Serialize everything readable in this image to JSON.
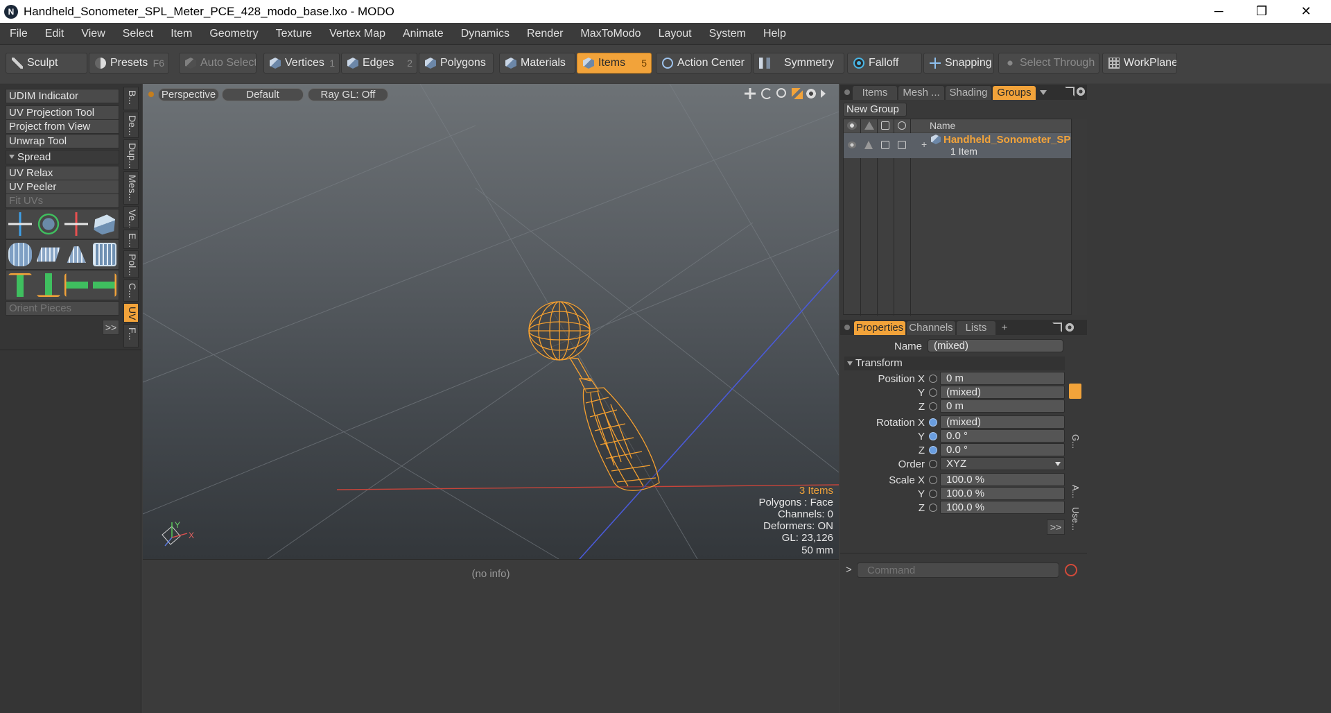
{
  "window": {
    "title": "Handheld_Sonometer_SPL_Meter_PCE_428_modo_base.lxo - MODO",
    "minimize": "─",
    "maximize": "❐",
    "close": "✕"
  },
  "menu": [
    "File",
    "Edit",
    "View",
    "Select",
    "Item",
    "Geometry",
    "Texture",
    "Vertex Map",
    "Animate",
    "Dynamics",
    "Render",
    "MaxToModo",
    "Layout",
    "System",
    "Help"
  ],
  "toolbar": {
    "sculpt": "Sculpt",
    "presets": "Presets",
    "presets_key": "F6",
    "auto_select": "Auto Select",
    "vertices": "Vertices",
    "vertices_key": "1",
    "edges": "Edges",
    "edges_key": "2",
    "polygons": "Polygons",
    "materials": "Materials",
    "items": "Items",
    "items_key": "5",
    "action_center": "Action Center",
    "symmetry": "Symmetry",
    "falloff": "Falloff",
    "snapping": "Snapping",
    "select_through": "Select Through",
    "workplane": "WorkPlane"
  },
  "left_tools": {
    "udim": "UDIM Indicator",
    "uv_projection": "UV Projection Tool",
    "project_from_view": "Project from View",
    "unwrap": "Unwrap Tool",
    "spread": "Spread",
    "uv_relax": "UV Relax",
    "uv_peeler": "UV Peeler",
    "fit_uvs": "Fit UVs",
    "orient_pieces": "Orient Pieces",
    "more": ">>"
  },
  "vertical_tabs": [
    "B...",
    "De...",
    "Dup...",
    "Mes...",
    "Ve...",
    "E...",
    "Pol...",
    "C...",
    "UV",
    "F..."
  ],
  "viewport": {
    "perspective": "Perspective",
    "default": "Default",
    "raygl": "Ray GL: Off",
    "info": {
      "items": "3 Items",
      "polygons": "Polygons : Face",
      "channels": "Channels: 0",
      "deformers": "Deformers: ON",
      "gl": "GL: 23,126",
      "scale": "50 mm"
    },
    "axis_x": "X",
    "axis_y": "Y"
  },
  "status": "(no info)",
  "groups_panel": {
    "tabs": [
      "Items",
      "Mesh ...",
      "Shading",
      "Groups"
    ],
    "new_group": "New Group",
    "col_name": "Name",
    "item_name": "Handheld_Sonometer_SP ...",
    "item_sub": "1 Item"
  },
  "props_panel": {
    "tabs": [
      "Properties",
      "Channels",
      "Lists",
      "+"
    ],
    "name_label": "Name",
    "name_value": "(mixed)",
    "transform": "Transform",
    "position_x_label": "Position X",
    "position_x": "0 m",
    "position_y": "(mixed)",
    "position_z": "0 m",
    "rotation_x_label": "Rotation X",
    "rotation_x": "(mixed)",
    "rotation_y": "0.0 °",
    "rotation_z": "0.0 °",
    "order_label": "Order",
    "order": "XYZ",
    "scale_x_label": "Scale X",
    "scale_x": "100.0 %",
    "scale_y": "100.0 %",
    "scale_z": "100.0 %",
    "y_label": "Y",
    "z_label": "Z",
    "more": ">>",
    "side_tabs": [
      "G...",
      "A...",
      "Use..."
    ]
  },
  "command": {
    "prompt": ">",
    "placeholder": "Command"
  },
  "colors": {
    "accent": "#f2a33a",
    "mesh": "#f5a030"
  }
}
